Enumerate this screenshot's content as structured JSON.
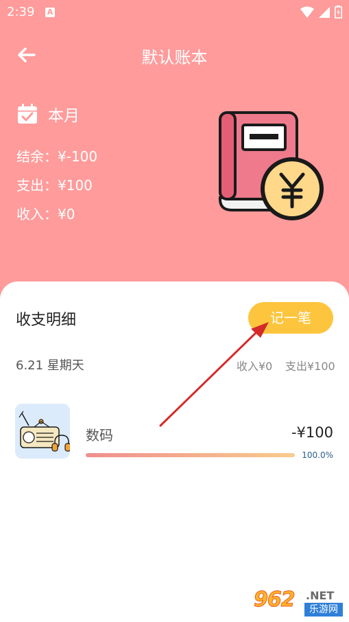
{
  "status_bar": {
    "time": "2:39",
    "notification_badge": "A"
  },
  "header": {
    "title": "默认账本",
    "back_icon": "arrow-left-icon"
  },
  "summary": {
    "period_label": "本月",
    "balance": "结余：¥-100",
    "expense": "支出：¥100",
    "income": "收入：¥0"
  },
  "details": {
    "title": "收支明细",
    "record_button": "记一笔",
    "date": "6.21 星期天",
    "day_income": "收入¥0",
    "day_expense": "支出¥100",
    "entries": [
      {
        "icon": "radio-icon",
        "category": "数码",
        "amount": "-¥100",
        "percent_label": "100.0%",
        "percent": 100
      }
    ]
  },
  "watermark": {
    "number": "962",
    "suffix": ".NET",
    "site": "乐游网"
  },
  "colors": {
    "header_bg": "#ff9b9b",
    "button": "#fdc53e",
    "progress_start": "#ef8e8e",
    "progress_end": "#f9cc8c",
    "arrow": "#d42a2a"
  }
}
